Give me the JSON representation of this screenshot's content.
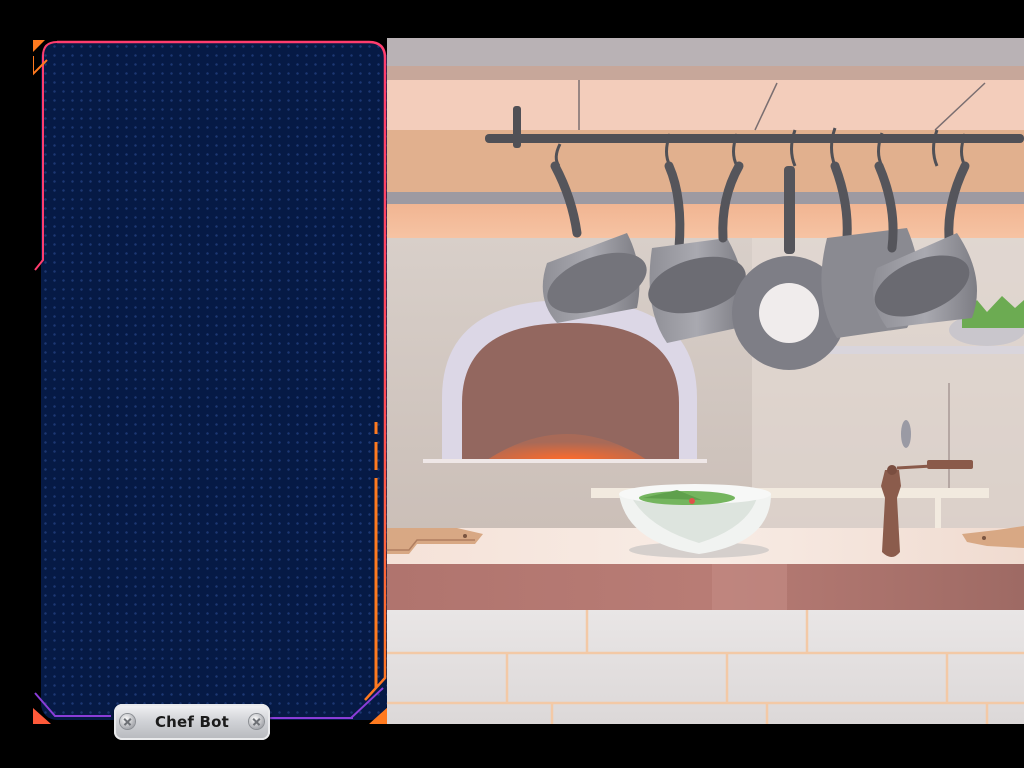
{
  "character": {
    "name": "Chef Bot"
  },
  "scene": {
    "setting": "kitchen",
    "icons": [
      "pizza-oven",
      "hanging-pots-and-pans",
      "salad-bowl",
      "pepper-mill",
      "cutting-boards"
    ]
  },
  "colors": {
    "panel_background": "#061a45",
    "panel_border_accent": "#ff3d6e",
    "panel_border_orange": "#ff7a1f",
    "panel_border_purple": "#8a3dd8"
  }
}
